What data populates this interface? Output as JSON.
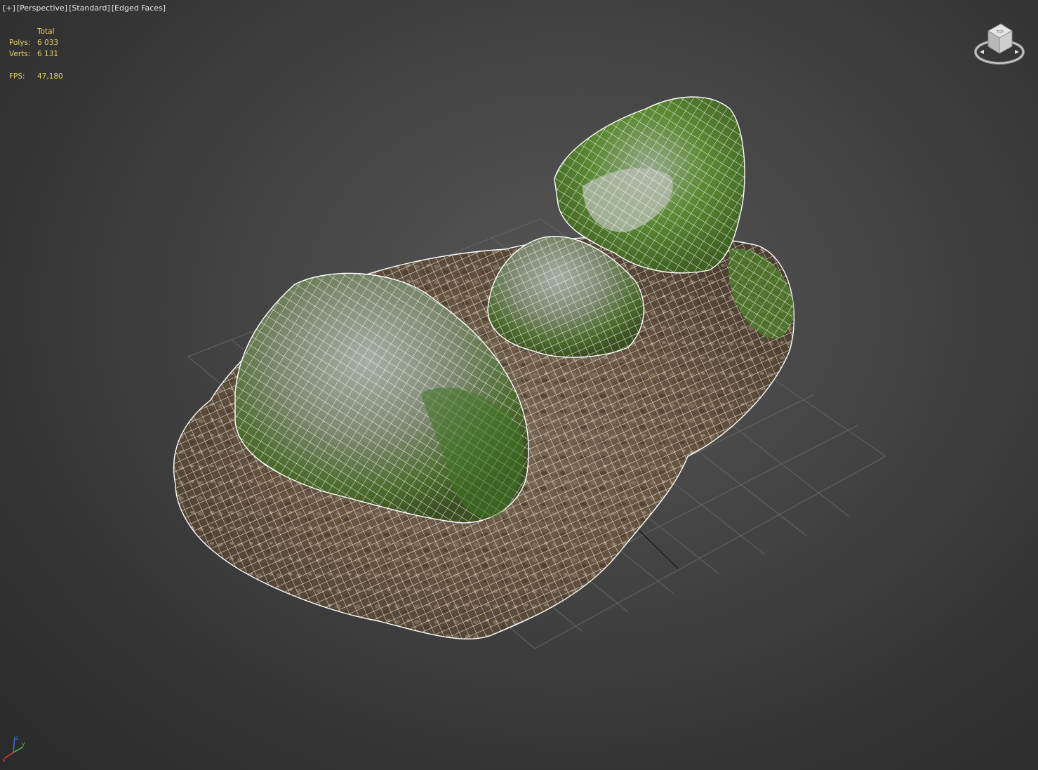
{
  "viewport": {
    "labels": [
      "[+]",
      "[Perspective]",
      "[Standard]",
      "[Edged Faces]"
    ]
  },
  "stats": {
    "column_header": "Total",
    "polys_label": "Polys:",
    "polys_value": "6 033",
    "verts_label": "Verts:",
    "verts_value": "6 131",
    "fps_label": "FPS:",
    "fps_value": "47,180"
  },
  "viewcube": {
    "icon": "viewcube-icon",
    "face_label": "TOP"
  },
  "axis_tripod": {
    "icon": "axis-tripod-icon",
    "x": "x",
    "y": "y",
    "z": "z"
  },
  "colors": {
    "background": "#3a3a3a",
    "stats_text": "#e8d36a",
    "label_text": "#e6e6e6",
    "wireframe": "#ffffff",
    "moss": "#4f7a2c",
    "rock": "#8e958d",
    "ground": "#6b5a45"
  }
}
